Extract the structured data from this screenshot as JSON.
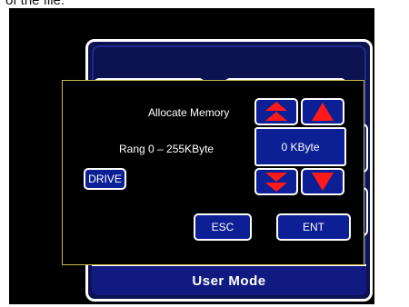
{
  "page": {
    "caption": "of the file."
  },
  "background_window": {
    "footer_label": "User Mode"
  },
  "dialog": {
    "allocate_label": "Allocate Memory",
    "range_label": "Rang 0 – 255KByte",
    "value": "0 KByte",
    "drive_label": "DRIVE",
    "esc_label": "ESC",
    "ent_label": "ENT"
  },
  "icons": {
    "fast_up": "double-up-arrow-icon",
    "up": "up-arrow-icon",
    "fast_down": "double-down-arrow-icon",
    "down": "down-arrow-icon"
  },
  "colors": {
    "button_fill": "#0d1f94",
    "arrow_red": "#ff1a1a",
    "dialog_border": "#c8b84a",
    "screen_bg": "#000000"
  }
}
